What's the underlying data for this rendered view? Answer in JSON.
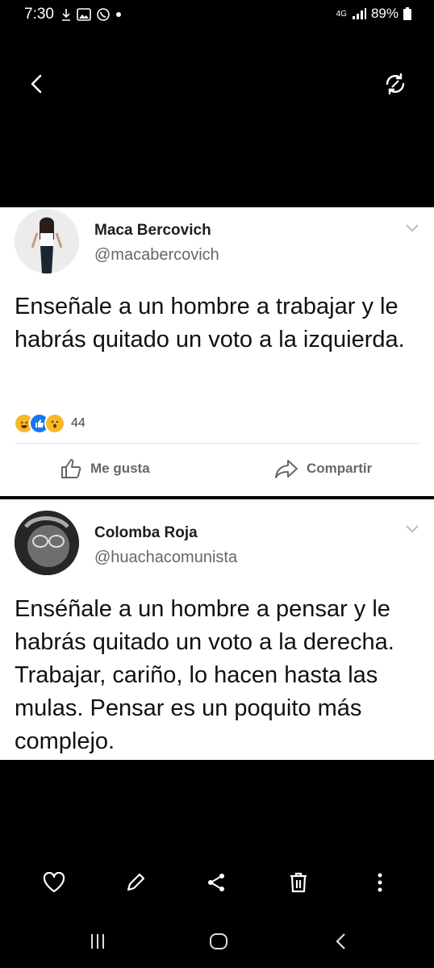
{
  "status": {
    "time": "7:30",
    "network": "4G",
    "battery": "89%"
  },
  "posts": [
    {
      "name": "Maca Bercovich",
      "handle": "@macabercovich",
      "text": "Enseñale a un hombre a trabajar y le habrás quitado un voto a la izquierda.",
      "reactions": [
        "haha",
        "like",
        "wow"
      ],
      "reaction_count": "44",
      "like_label": "Me gusta",
      "share_label": "Compartir"
    },
    {
      "name": "Colomba Roja",
      "handle": "@huachacomunista",
      "text": "Enséñale a un hombre a pensar y le habrás quitado un voto a la derecha. Trabajar, cariño, lo hacen hasta las mulas. Pensar es un poquito más complejo."
    }
  ],
  "colors": {
    "card_bg": "#ffffff",
    "text": "#1c1e21",
    "muted": "#65676b",
    "like_blue": "#1877f2",
    "haha_yellow": "#f7b928"
  },
  "icons": {
    "topbar": [
      "back-icon",
      "rotate-icon"
    ],
    "toolbar": [
      "heart-icon",
      "edit-icon",
      "share-icon",
      "trash-icon",
      "more-icon"
    ],
    "nav": [
      "recents-icon",
      "home-icon",
      "back-nav-icon"
    ]
  }
}
